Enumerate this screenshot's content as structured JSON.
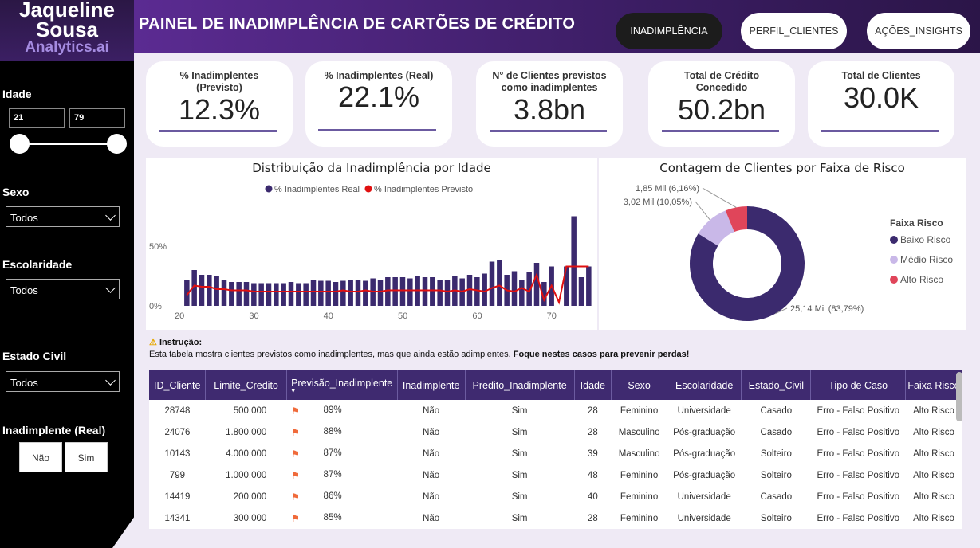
{
  "logo": {
    "line1": "Jaqueline",
    "line2": "Sousa",
    "line3": "Analytics.ai"
  },
  "header": {
    "title": "PAINEL DE INADIMPLÊNCIA DE CARTÕES DE CRÉDITO"
  },
  "nav": [
    {
      "label": "INADIMPLÊNCIA",
      "active": true
    },
    {
      "label": "PERFIL_CLIENTES",
      "active": false
    },
    {
      "label": "AÇÕES_INSIGHTS",
      "active": false
    }
  ],
  "filters": {
    "idade": {
      "label": "Idade",
      "min": "21",
      "max": "79"
    },
    "sexo": {
      "label": "Sexo",
      "value": "Todos"
    },
    "escolaridade": {
      "label": "Escolaridade",
      "value": "Todos"
    },
    "estado_civil": {
      "label": "Estado Civil",
      "value": "Todos"
    },
    "inadimplente": {
      "label": "Inadimplente (Real)",
      "options": [
        "Não",
        "Sim"
      ]
    }
  },
  "kpis": [
    {
      "title": "% Inadimplentes (Previsto)",
      "value": "12.3%"
    },
    {
      "title": "% Inadimplentes (Real)",
      "value": "22.1%"
    },
    {
      "title": "N° de Clientes previstos como inadimplentes",
      "value": "3.8bn"
    },
    {
      "title": "Total de Crédito Concedido",
      "value": "50.2bn"
    },
    {
      "title": "Total de Clientes",
      "value": "30.0K"
    }
  ],
  "colors": {
    "purple": "#3f2a70",
    "real": "#3b2a6e",
    "previsto": "#e01010",
    "baixo": "#3b2a6e",
    "medio": "#c9b8e8",
    "alto": "#e0455a"
  },
  "chart_data": [
    {
      "type": "bar",
      "title": "Distribuição da Inadimplência por Idade",
      "x": [
        21,
        22,
        23,
        24,
        25,
        26,
        27,
        28,
        29,
        30,
        31,
        32,
        33,
        34,
        35,
        36,
        37,
        38,
        39,
        40,
        41,
        42,
        43,
        44,
        45,
        46,
        47,
        48,
        49,
        50,
        51,
        52,
        53,
        54,
        55,
        56,
        57,
        58,
        59,
        60,
        61,
        62,
        63,
        64,
        65,
        66,
        67,
        68,
        69,
        70,
        71,
        72,
        73,
        74,
        75
      ],
      "xticks": [
        20,
        30,
        40,
        50,
        60,
        70
      ],
      "yticks": [
        "0%",
        "50%"
      ],
      "ylim": [
        0,
        0.8
      ],
      "series": [
        {
          "name": "% Inadimplentes Real",
          "kind": "bar",
          "values": [
            0.22,
            0.3,
            0.26,
            0.26,
            0.25,
            0.22,
            0.2,
            0.2,
            0.2,
            0.19,
            0.19,
            0.19,
            0.19,
            0.19,
            0.2,
            0.19,
            0.19,
            0.22,
            0.21,
            0.21,
            0.2,
            0.21,
            0.22,
            0.22,
            0.21,
            0.23,
            0.22,
            0.24,
            0.24,
            0.24,
            0.23,
            0.25,
            0.24,
            0.24,
            0.22,
            0.22,
            0.25,
            0.23,
            0.26,
            0.24,
            0.27,
            0.37,
            0.38,
            0.26,
            0.29,
            0.22,
            0.28,
            0.36,
            0.2,
            0.33,
            0.0,
            0.33,
            0.75,
            0.24,
            0.33
          ]
        },
        {
          "name": "% Inadimplentes Previsto",
          "kind": "line",
          "values": [
            0.09,
            0.17,
            0.16,
            0.16,
            0.14,
            0.14,
            0.13,
            0.13,
            0.13,
            0.12,
            0.12,
            0.12,
            0.12,
            0.12,
            0.12,
            0.12,
            0.12,
            0.12,
            0.12,
            0.12,
            0.12,
            0.13,
            0.12,
            0.12,
            0.13,
            0.12,
            0.12,
            0.13,
            0.13,
            0.13,
            0.13,
            0.13,
            0.13,
            0.13,
            0.13,
            0.12,
            0.13,
            0.12,
            0.14,
            0.13,
            0.12,
            0.15,
            0.17,
            0.13,
            0.12,
            0.15,
            0.12,
            0.26,
            0.05,
            0.17,
            0.03,
            0.33,
            0.33,
            0.33,
            0.33
          ]
        }
      ]
    },
    {
      "type": "pie",
      "title": "Contagem de Clientes por Faixa de Risco",
      "legend_title": "Faixa Risco",
      "legend_position": "right",
      "categories": [
        "Baixo Risco",
        "Médio Risco",
        "Alto Risco"
      ],
      "values": [
        25140,
        3020,
        1850
      ],
      "labels": [
        "25,14 Mil (83,79%)",
        "3,02 Mil (10,05%)",
        "1,85 Mil (6,16%)"
      ]
    }
  ],
  "instruction": {
    "title": "Instrução:",
    "text": "Esta tabela mostra clientes previstos como inadimplentes, mas que ainda estão adimplentes.",
    "bold": "Foque nestes casos para prevenir perdas!"
  },
  "table": {
    "columns": [
      "ID_Cliente",
      "Limite_Credito",
      "Previsão_Inadimplente",
      "Inadimplente",
      "Predito_Inadimplente",
      "Idade",
      "Sexo",
      "Escolaridade",
      "Estado_Civil",
      "Tipo de Caso",
      "Faixa Risco"
    ],
    "rows": [
      [
        "28748",
        "500.000",
        "89%",
        "Não",
        "Sim",
        "28",
        "Feminino",
        "Universidade",
        "Casado",
        "Erro - Falso Positivo",
        "Alto Risco"
      ],
      [
        "24076",
        "1.800.000",
        "88%",
        "Não",
        "Sim",
        "28",
        "Masculino",
        "Pós-graduação",
        "Casado",
        "Erro - Falso Positivo",
        "Alto Risco"
      ],
      [
        "10143",
        "4.000.000",
        "87%",
        "Não",
        "Sim",
        "39",
        "Masculino",
        "Pós-graduação",
        "Solteiro",
        "Erro - Falso Positivo",
        "Alto Risco"
      ],
      [
        "799",
        "1.000.000",
        "87%",
        "Não",
        "Sim",
        "48",
        "Feminino",
        "Pós-graduação",
        "Solteiro",
        "Erro - Falso Positivo",
        "Alto Risco"
      ],
      [
        "14419",
        "200.000",
        "86%",
        "Não",
        "Sim",
        "40",
        "Feminino",
        "Universidade",
        "Casado",
        "Erro - Falso Positivo",
        "Alto Risco"
      ],
      [
        "14341",
        "300.000",
        "85%",
        "Não",
        "Sim",
        "28",
        "Feminino",
        "Universidade",
        "Solteiro",
        "Erro - Falso Positivo",
        "Alto Risco"
      ]
    ]
  }
}
